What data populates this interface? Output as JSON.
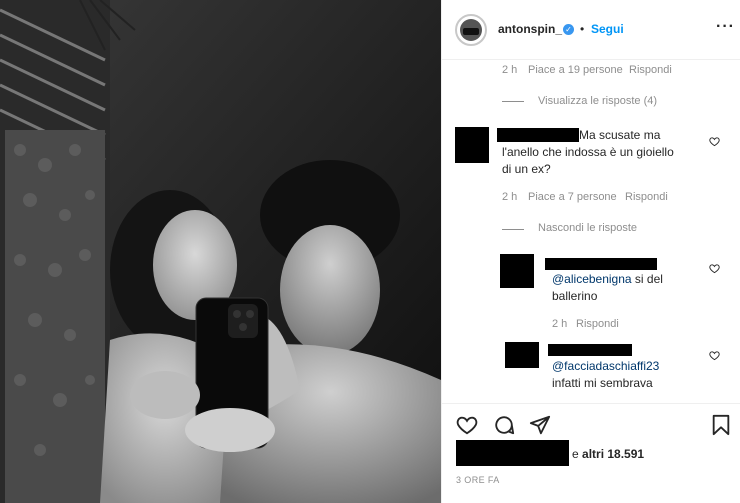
{
  "header": {
    "username": "antonspin_",
    "separator": "•",
    "follow_label": "Segui",
    "more_label": "···"
  },
  "comments": {
    "top_meta": {
      "time": "2 h",
      "likes": "Piace a 19 persone",
      "reply": "Rispondi"
    },
    "view_replies": "Visualizza le risposte (4)",
    "c2": {
      "text_line1": "Ma scusate ma",
      "text_line2": "l'anello che indossa è un gioiello",
      "text_line3": "di un ex?",
      "time": "2 h",
      "likes": "Piace a 7 persone",
      "reply": "Rispondi"
    },
    "hide_replies": "Nascondi le risposte",
    "r1": {
      "mention": "@alicebenigna",
      "text_a": " si del",
      "text_b": "ballerino",
      "time": "2 h",
      "reply": "Rispondi"
    },
    "r2": {
      "mention": "@facciadaschiaffi23",
      "text_b": "infatti mi sembrava"
    }
  },
  "actions": {
    "likes_and": "e",
    "likes_others": "altri 18.591",
    "time": "3 ORE FA"
  },
  "colors": {
    "link_blue": "#0095f6",
    "mention_blue": "#00376b",
    "meta_gray": "#8e8e8e",
    "text": "#262626"
  },
  "icons": [
    "verified-badge-icon",
    "more-options-icon",
    "heart-icon",
    "comment-icon",
    "share-icon",
    "bookmark-icon"
  ]
}
